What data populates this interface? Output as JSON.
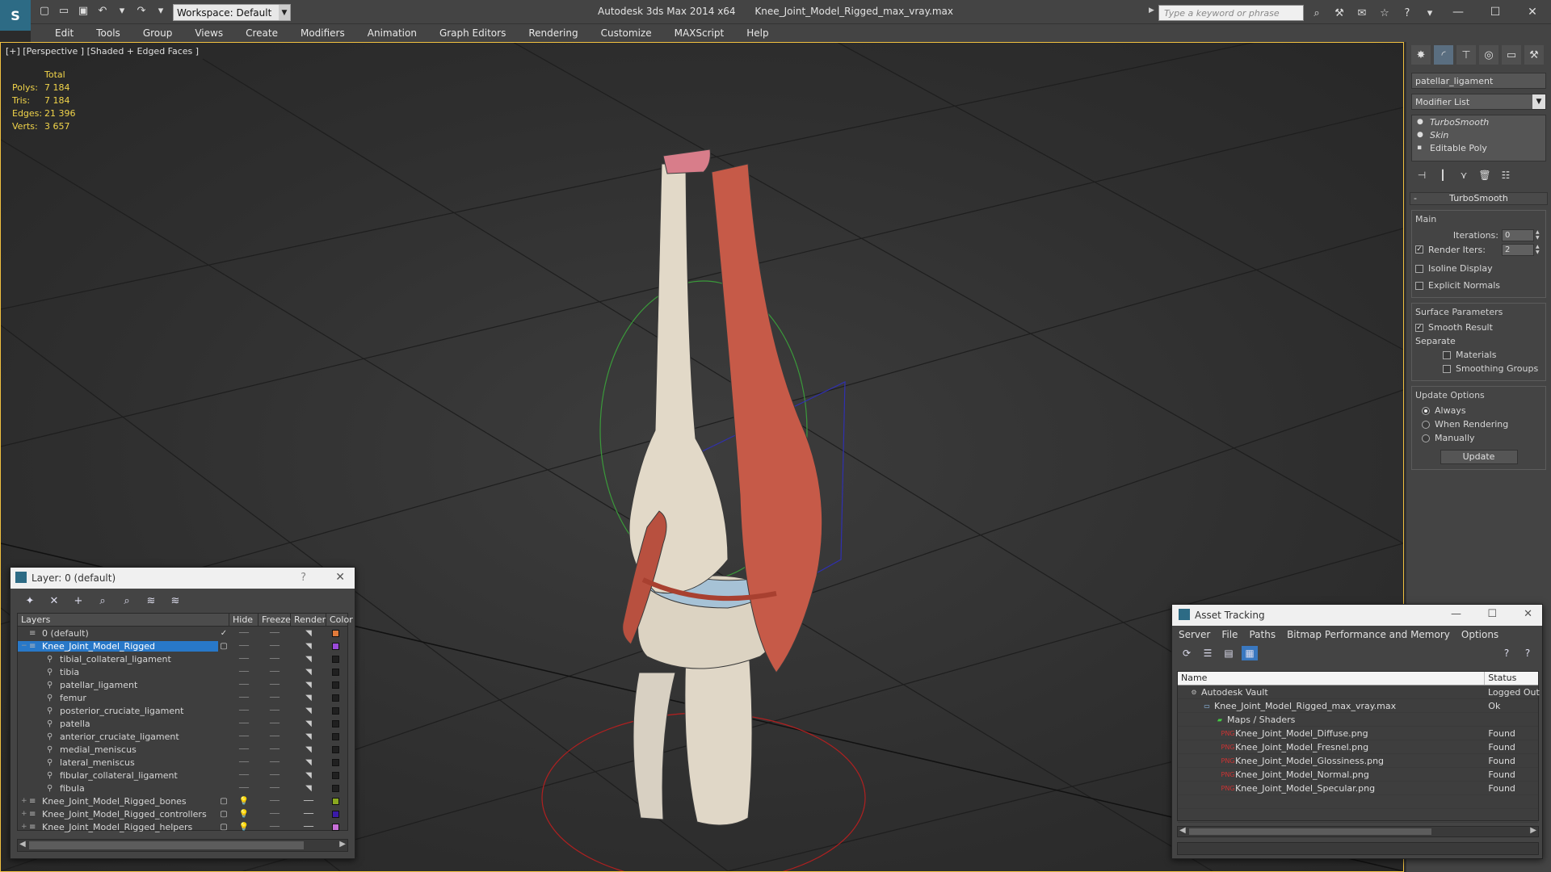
{
  "titlebar": {
    "app": "Autodesk 3ds Max  2014 x64",
    "file": "Knee_Joint_Model_Rigged_max_vray.max",
    "workspace": "Workspace: Default",
    "search_placeholder": "Type a keyword or phrase"
  },
  "menu": [
    "Edit",
    "Tools",
    "Group",
    "Views",
    "Create",
    "Modifiers",
    "Animation",
    "Graph Editors",
    "Rendering",
    "Customize",
    "MAXScript",
    "Help"
  ],
  "viewport": {
    "label": "[+] [Perspective ] [Shaded + Edged Faces ]",
    "stats": {
      "header": "Total",
      "rows": [
        {
          "k": "Polys:",
          "v": "7 184"
        },
        {
          "k": "Tris:",
          "v": "7 184"
        },
        {
          "k": "Edges:",
          "v": "21 396"
        },
        {
          "k": "Verts:",
          "v": "3 657"
        }
      ]
    }
  },
  "command_panel": {
    "object_name": "patellar_ligament",
    "modifier_list": "Modifier List",
    "stack": [
      "TurboSmooth",
      "Skin",
      "Editable Poly"
    ],
    "rollout": "TurboSmooth",
    "main_group": "Main",
    "iterations_label": "Iterations:",
    "iterations": "0",
    "render_iters_label": "Render Iters:",
    "render_iters": "2",
    "isoline": "Isoline Display",
    "explicit": "Explicit Normals",
    "surface_group": "Surface Parameters",
    "smooth_result": "Smooth Result",
    "separate": "Separate",
    "materials": "Materials",
    "smoothing_groups": "Smoothing Groups",
    "update_group": "Update Options",
    "always": "Always",
    "when_rendering": "When Rendering",
    "manually": "Manually",
    "update_button": "Update"
  },
  "layer_dialog": {
    "title": "Layer: 0 (default)",
    "columns": [
      "Layers",
      "Hide",
      "Freeze",
      "Render",
      "Color"
    ],
    "rows": [
      {
        "name": "0 (default)",
        "color": "#e07a3a"
      },
      {
        "name": "Knee_Joint_Model_Rigged",
        "color": "#9a4ad8"
      },
      {
        "name": "tibial_collateral_ligament",
        "color": "#202020"
      },
      {
        "name": "tibia",
        "color": "#202020"
      },
      {
        "name": "patellar_ligament",
        "color": "#202020"
      },
      {
        "name": "femur",
        "color": "#202020"
      },
      {
        "name": "posterior_cruciate_ligament",
        "color": "#202020"
      },
      {
        "name": "patella",
        "color": "#202020"
      },
      {
        "name": "anterior_cruciate_ligament",
        "color": "#202020"
      },
      {
        "name": "medial_meniscus",
        "color": "#202020"
      },
      {
        "name": "lateral_meniscus",
        "color": "#202020"
      },
      {
        "name": "fibular_collateral_ligament",
        "color": "#202020"
      },
      {
        "name": "fibula",
        "color": "#202020"
      },
      {
        "name": "Knee_Joint_Model_Rigged_bones",
        "color": "#8aa820"
      },
      {
        "name": "Knee_Joint_Model_Rigged_controllers",
        "color": "#3a1aa8"
      },
      {
        "name": "Knee_Joint_Model_Rigged_helpers",
        "color": "#c870d8"
      }
    ]
  },
  "asset_dialog": {
    "title": "Asset Tracking",
    "menu": [
      "Server",
      "File",
      "Paths",
      "Bitmap Performance and Memory",
      "Options"
    ],
    "columns": [
      "Name",
      "Status"
    ],
    "rows": [
      {
        "name": "Autodesk Vault",
        "status": "Logged Out"
      },
      {
        "name": "Knee_Joint_Model_Rigged_max_vray.max",
        "status": "Ok"
      },
      {
        "name": "Maps / Shaders",
        "status": ""
      },
      {
        "name": "Knee_Joint_Model_Diffuse.png",
        "status": "Found"
      },
      {
        "name": "Knee_Joint_Model_Fresnel.png",
        "status": "Found"
      },
      {
        "name": "Knee_Joint_Model_Glossiness.png",
        "status": "Found"
      },
      {
        "name": "Knee_Joint_Model_Normal.png",
        "status": "Found"
      },
      {
        "name": "Knee_Joint_Model_Specular.png",
        "status": "Found"
      }
    ]
  }
}
